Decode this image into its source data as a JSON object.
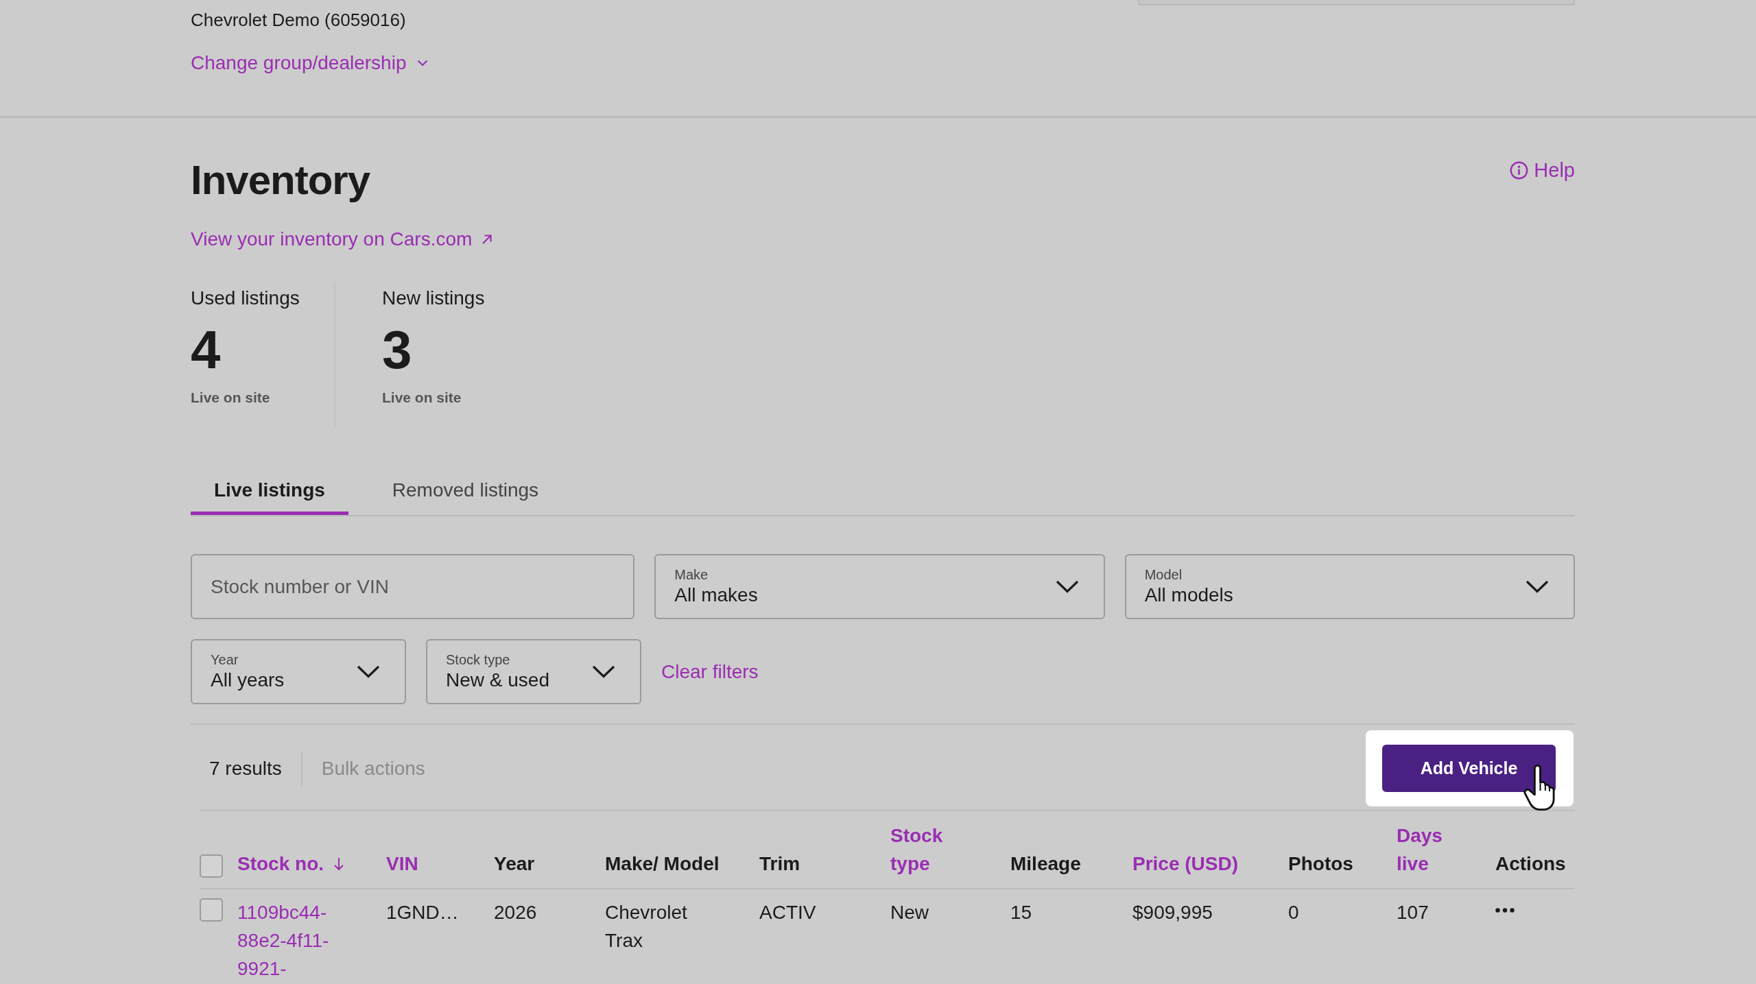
{
  "header": {
    "account": "Chevrolet Demo (6059016)",
    "change_link": "Change group/dealership"
  },
  "title": "Inventory",
  "help_link": "Help",
  "site_link": "View your inventory on Cars.com",
  "stats": [
    {
      "label": "Used listings",
      "value": "4",
      "caption": "Live on site"
    },
    {
      "label": "New listings",
      "value": "3",
      "caption": "Live on site"
    }
  ],
  "tabs": [
    {
      "label": "Live listings",
      "selected": true
    },
    {
      "label": "Removed listings",
      "selected": false
    }
  ],
  "filters": {
    "rows": [
      [
        {
          "kind": "search",
          "placeholder": "Stock number or VIN"
        },
        {
          "kind": "select",
          "label": "Make",
          "value": "All makes"
        },
        {
          "kind": "select",
          "label": "Model",
          "value": "All models"
        }
      ],
      [
        {
          "kind": "select",
          "label": "Year",
          "value": "All years"
        },
        {
          "kind": "select",
          "label": "Stock type",
          "value": "New & used"
        }
      ]
    ],
    "clear_link": "Clear filters"
  },
  "toolbar": {
    "results": "7 results",
    "bulk_actions": {
      "label": "Bulk actions",
      "disabled": true
    },
    "add_button": "Add Vehicle"
  },
  "table": {
    "select_all": {
      "checked": false
    },
    "columns": [
      {
        "label": "Stock no.",
        "sortable": true,
        "sorted": true
      },
      {
        "label": "VIN",
        "sortable": true,
        "sorted": false
      },
      {
        "label": "Year",
        "sortable": false,
        "sorted": false
      },
      {
        "label": "Make/ Model",
        "sortable": false,
        "sorted": false
      },
      {
        "label": "Trim",
        "sortable": false,
        "sorted": false
      },
      {
        "label": "Stock type",
        "sortable": true,
        "sorted": false
      },
      {
        "label": "Mileage",
        "sortable": false,
        "sorted": false
      },
      {
        "label": "Price (USD)",
        "sortable": true,
        "sorted": false
      },
      {
        "label": "Photos",
        "sortable": false,
        "sorted": false
      },
      {
        "label": "Days live",
        "sortable": true,
        "sorted": false
      },
      {
        "label": "Actions",
        "sortable": false,
        "sorted": false
      }
    ],
    "rows": [
      {
        "checked": false,
        "cells": [
          {
            "kind": "link",
            "text": "1109bc44-88e2-4f11-9921-"
          },
          {
            "kind": "text",
            "text": "1GND…"
          },
          {
            "kind": "text",
            "text": "2026"
          },
          {
            "kind": "text",
            "text": "Chevrolet Trax"
          },
          {
            "kind": "text",
            "text": "ACTIV"
          },
          {
            "kind": "text",
            "text": "New"
          },
          {
            "kind": "text",
            "text": "15"
          },
          {
            "kind": "text",
            "text": "$909,995"
          },
          {
            "kind": "text",
            "text": "0"
          },
          {
            "kind": "text",
            "text": "107"
          },
          {
            "kind": "actions"
          }
        ]
      }
    ]
  }
}
